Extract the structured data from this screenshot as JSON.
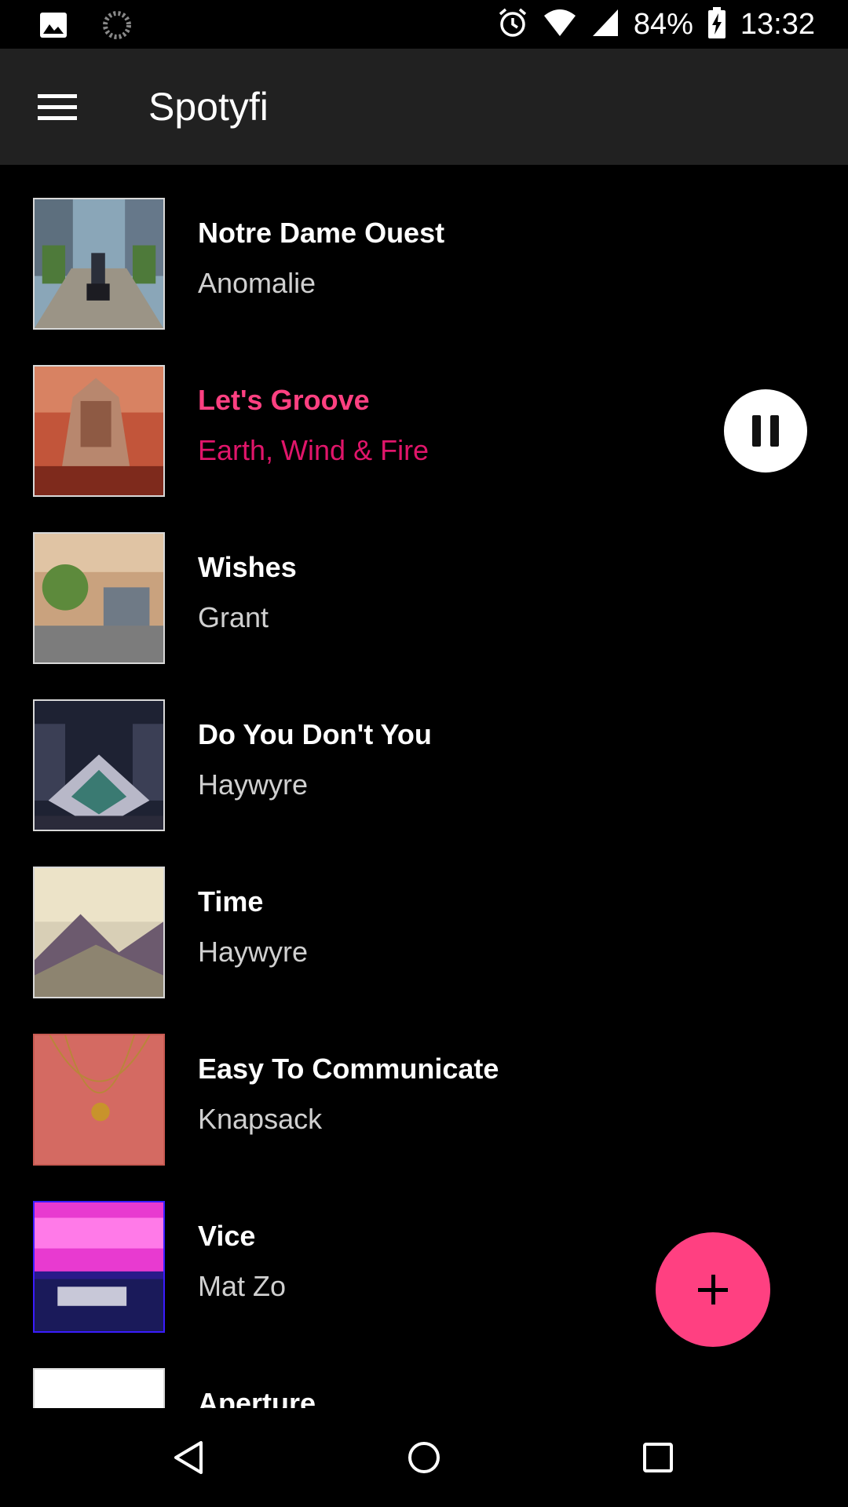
{
  "status_bar": {
    "battery_percent": "84%",
    "time": "13:32",
    "icons": [
      "image-icon",
      "sync-icon",
      "alarm-icon",
      "wifi-icon",
      "signal-icon",
      "battery-charging-icon"
    ]
  },
  "app_bar": {
    "title": "Spotyfi",
    "menu_icon": "hamburger-menu-icon"
  },
  "tracks": [
    {
      "title": "Notre Dame Ouest",
      "artist": "Anomalie"
    },
    {
      "title": "Let's Groove",
      "artist": "Earth, Wind & Fire",
      "playing": true
    },
    {
      "title": "Wishes",
      "artist": "Grant"
    },
    {
      "title": "Do You Don't You",
      "artist": "Haywyre"
    },
    {
      "title": "Time",
      "artist": "Haywyre"
    },
    {
      "title": "Easy To Communicate",
      "artist": "Knapsack"
    },
    {
      "title": "Vice",
      "artist": "Mat Zo"
    },
    {
      "title": "Aperture",
      "artist": ""
    }
  ],
  "playback": {
    "control_icon": "pause-icon"
  },
  "fab": {
    "icon": "plus-icon"
  },
  "colors": {
    "accent": "#ff4081",
    "active_artist": "#e0156a",
    "app_bar": "#212121",
    "background": "#000000"
  },
  "nav_bar": {
    "icons": [
      "back-icon",
      "home-icon",
      "recents-icon"
    ]
  }
}
